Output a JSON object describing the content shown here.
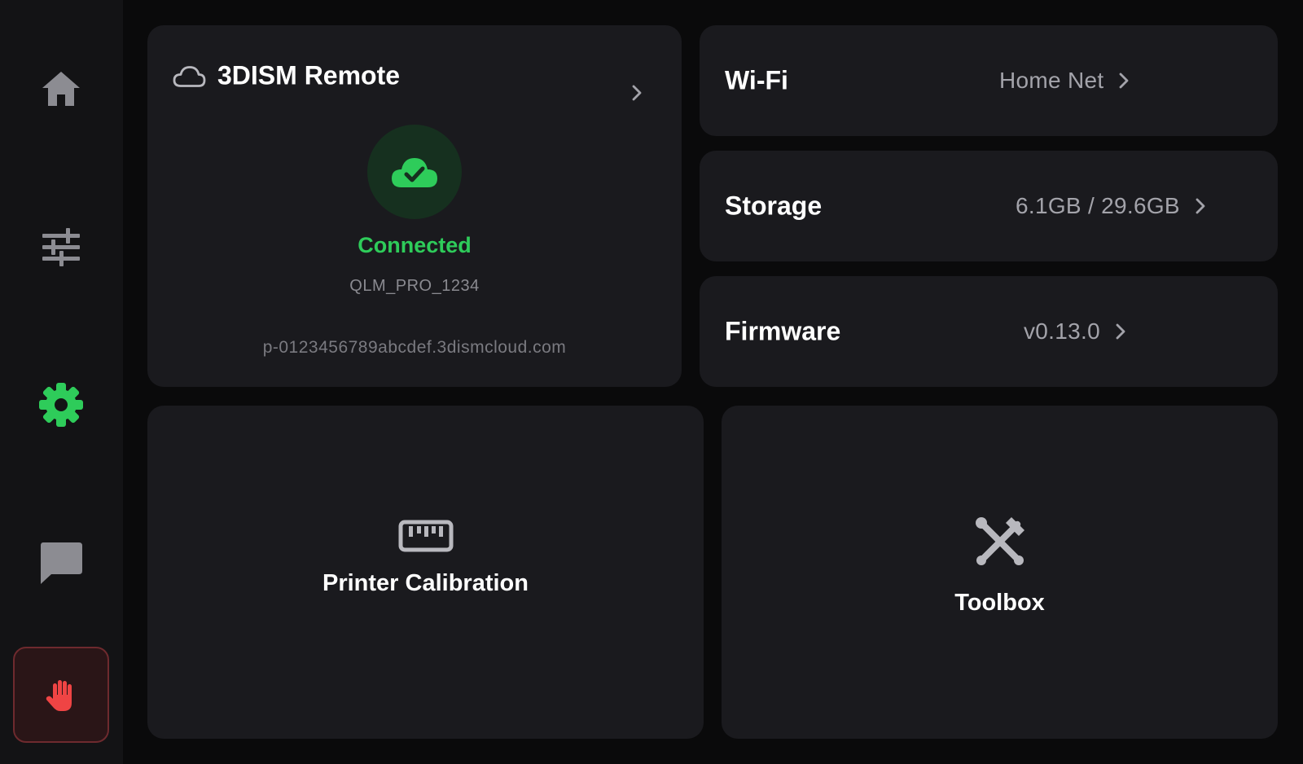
{
  "sidebar": {
    "items": [
      {
        "name": "home",
        "icon": "home-icon",
        "active": false
      },
      {
        "name": "tune",
        "icon": "sliders-icon",
        "active": false
      },
      {
        "name": "settings",
        "icon": "gear-icon",
        "active": true
      },
      {
        "name": "messages",
        "icon": "chat-bubble-icon",
        "active": false
      },
      {
        "name": "emergency-stop",
        "icon": "hand-stop-icon",
        "active": false
      }
    ]
  },
  "remote": {
    "title": "3DISM Remote",
    "status": "Connected",
    "device_id": "QLM_PRO_1234",
    "url": "p-0123456789abcdef.3dismcloud.com"
  },
  "settings": {
    "wifi": {
      "label": "Wi-Fi",
      "value": "Home Net"
    },
    "storage": {
      "label": "Storage",
      "value": "6.1GB / 29.6GB"
    },
    "firmware": {
      "label": "Firmware",
      "value": "v0.13.0"
    }
  },
  "actions": {
    "calibration": {
      "label": "Printer Calibration",
      "icon": "ruler-icon"
    },
    "toolbox": {
      "label": "Toolbox",
      "icon": "tools-icon"
    }
  },
  "colors": {
    "accent_green": "#2ecc5a",
    "icon_gray": "#8c8c92",
    "estop_red": "#ef4444",
    "card_bg": "#1a1a1e"
  }
}
